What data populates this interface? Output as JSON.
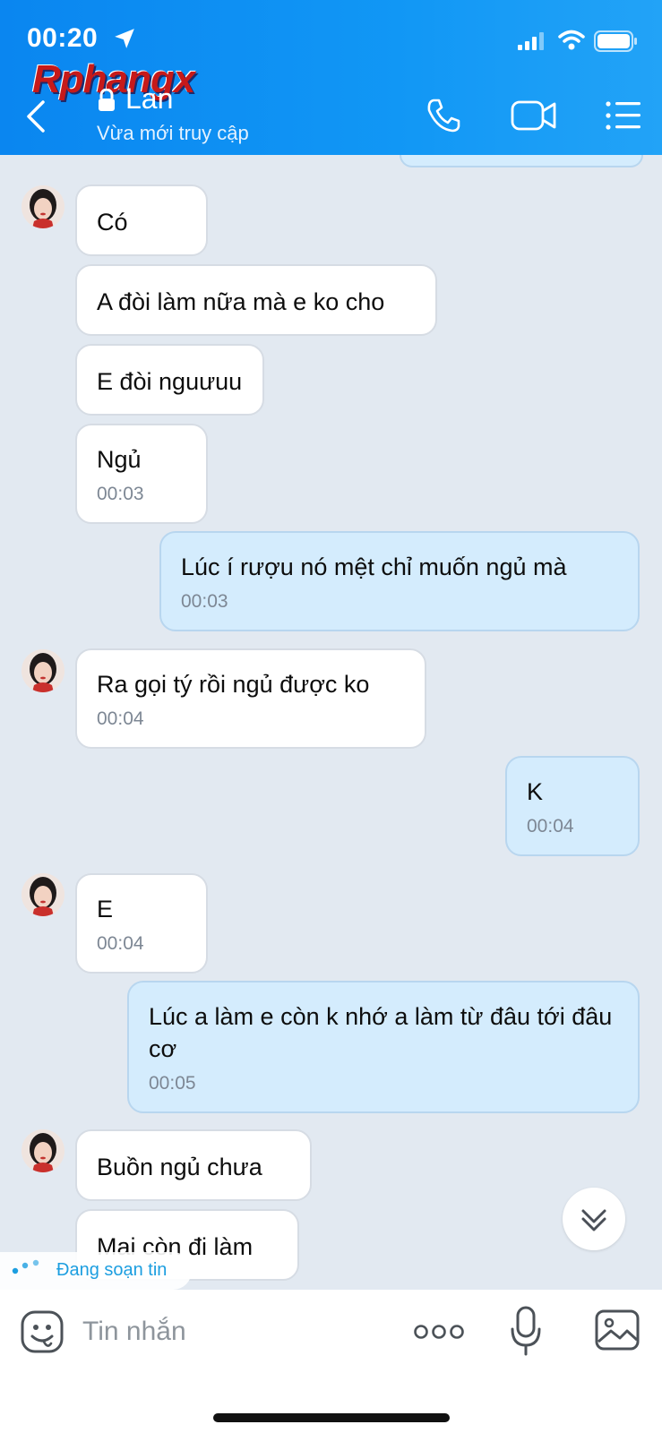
{
  "status_bar": {
    "time": "00:20"
  },
  "header": {
    "watermark": "Rphangx",
    "contact_name": "Lan",
    "contact_status": "Vừa mới truy cập"
  },
  "messages": [
    {
      "dir": "in",
      "text": "Có",
      "time": ""
    },
    {
      "dir": "in",
      "text": "A đòi làm nữa mà e ko cho",
      "time": ""
    },
    {
      "dir": "in",
      "text": "E đòi nguưuu",
      "time": ""
    },
    {
      "dir": "in",
      "text": "Ngủ",
      "time": "00:03"
    },
    {
      "dir": "out",
      "text": "Lúc í rượu nó mệt chỉ muốn ngủ mà",
      "time": "00:03"
    },
    {
      "dir": "in",
      "text": "Ra gọi tý rồi ngủ được ko",
      "time": "00:04"
    },
    {
      "dir": "out",
      "text": "K",
      "time": "00:04"
    },
    {
      "dir": "in",
      "text": "E",
      "time": "00:04"
    },
    {
      "dir": "out",
      "text": "Lúc a làm e còn k nhớ a làm từ đâu tới đâu cơ",
      "time": "00:05"
    },
    {
      "dir": "in",
      "text": "Buồn ngủ chưa",
      "time": ""
    },
    {
      "dir": "in",
      "text": "Mai còn đi làm",
      "time": ""
    }
  ],
  "typing_indicator": {
    "text": "Đang soạn tin"
  },
  "input": {
    "placeholder": "Tin nhắn",
    "value": ""
  },
  "icons": {
    "status": [
      "location-icon",
      "signal-icon",
      "wifi-icon",
      "battery-icon"
    ],
    "header": [
      "back-icon",
      "lock-icon",
      "call-icon",
      "video-call-icon",
      "menu-icon"
    ],
    "input": [
      "sticker-icon",
      "more-icon",
      "mic-icon",
      "image-icon"
    ],
    "chat": [
      "scroll-down-icon"
    ]
  },
  "colors": {
    "header_bg": "#0a86f0",
    "chat_bg": "#e2e9f1",
    "incoming_bubble": "#ffffff",
    "outgoing_bubble": "#d4ecfd",
    "typing_text": "#1c9ee0"
  }
}
